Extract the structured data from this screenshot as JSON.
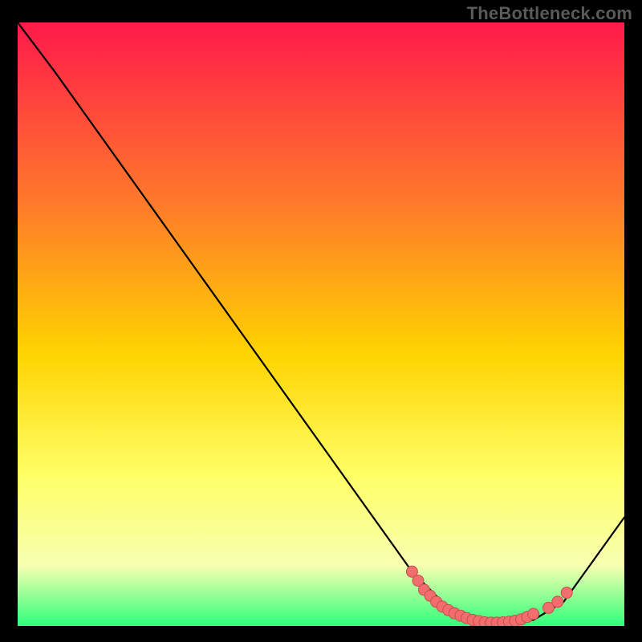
{
  "watermark": "TheBottleneck.com",
  "colors": {
    "frame_bg": "#000000",
    "grad_top": "#ff1a4a",
    "grad_mid1": "#ff7a2a",
    "grad_mid2": "#ffd400",
    "grad_mid3": "#ffff66",
    "grad_mid4": "#f7ffb0",
    "grad_bottom": "#2eff7a",
    "curve": "#000000",
    "marker_fill": "#f26d6d",
    "marker_stroke": "#c94d4d"
  },
  "chart_data": {
    "type": "line",
    "title": "",
    "xlabel": "",
    "ylabel": "",
    "xlim": [
      0,
      100
    ],
    "ylim": [
      0,
      100
    ],
    "series": [
      {
        "name": "curve",
        "x": [
          0,
          6,
          65,
          70,
          75,
          80,
          85,
          90,
          100
        ],
        "y": [
          100,
          92,
          9,
          4,
          1,
          0.6,
          1,
          4,
          18
        ]
      }
    ],
    "markers": [
      {
        "x": 65,
        "y": 9
      },
      {
        "x": 66,
        "y": 7.5
      },
      {
        "x": 67,
        "y": 6
      },
      {
        "x": 68,
        "y": 5
      },
      {
        "x": 69,
        "y": 4
      },
      {
        "x": 70,
        "y": 3.2
      },
      {
        "x": 71,
        "y": 2.6
      },
      {
        "x": 72,
        "y": 2.1
      },
      {
        "x": 73,
        "y": 1.7
      },
      {
        "x": 74,
        "y": 1.3
      },
      {
        "x": 75,
        "y": 1.0
      },
      {
        "x": 76,
        "y": 0.8
      },
      {
        "x": 77,
        "y": 0.6
      },
      {
        "x": 78,
        "y": 0.55
      },
      {
        "x": 79,
        "y": 0.55
      },
      {
        "x": 80,
        "y": 0.6
      },
      {
        "x": 81,
        "y": 0.7
      },
      {
        "x": 82,
        "y": 0.85
      },
      {
        "x": 83,
        "y": 1.1
      },
      {
        "x": 84,
        "y": 1.5
      },
      {
        "x": 85,
        "y": 2.0
      },
      {
        "x": 87.5,
        "y": 3.0
      },
      {
        "x": 89,
        "y": 4.0
      },
      {
        "x": 90.5,
        "y": 5.5
      }
    ]
  }
}
